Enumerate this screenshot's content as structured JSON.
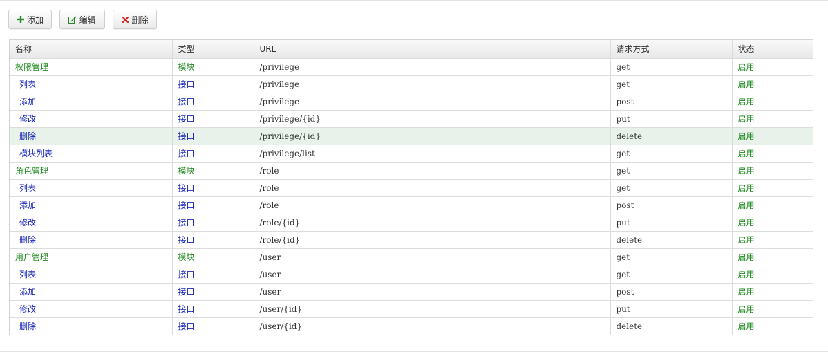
{
  "colors": {
    "module": "#1e8a1e",
    "api": "#1a27b8",
    "status": "#1e8a1e",
    "highlight_row": "#e8f2ea",
    "add_icon": "#2a8a2a",
    "delete_icon": "#d42020"
  },
  "toolbar": {
    "add_label": "添加",
    "add_icon": "plus-icon",
    "edit_label": "编辑",
    "edit_icon": "edit-icon",
    "delete_label": "删除",
    "delete_icon": "close-icon"
  },
  "table": {
    "columns": [
      "名称",
      "类型",
      "URL",
      "请求方式",
      "状态"
    ],
    "rows": [
      {
        "name": "权限管理",
        "type": "模块",
        "url": "/privilege",
        "method": "get",
        "status": "启用",
        "level": "module"
      },
      {
        "name": "列表",
        "type": "接口",
        "url": "/privilege",
        "method": "get",
        "status": "启用",
        "level": "api"
      },
      {
        "name": "添加",
        "type": "接口",
        "url": "/privilege",
        "method": "post",
        "status": "启用",
        "level": "api"
      },
      {
        "name": "修改",
        "type": "接口",
        "url": "/privilege/{id}",
        "method": "put",
        "status": "启用",
        "level": "api"
      },
      {
        "name": "删除",
        "type": "接口",
        "url": "/privilege/{id}",
        "method": "delete",
        "status": "启用",
        "level": "api",
        "highlighted": true
      },
      {
        "name": "模块列表",
        "type": "接口",
        "url": "/privilege/list",
        "method": "get",
        "status": "启用",
        "level": "api"
      },
      {
        "name": "角色管理",
        "type": "模块",
        "url": "/role",
        "method": "get",
        "status": "启用",
        "level": "module"
      },
      {
        "name": "列表",
        "type": "接口",
        "url": "/role",
        "method": "get",
        "status": "启用",
        "level": "api"
      },
      {
        "name": "添加",
        "type": "接口",
        "url": "/role",
        "method": "post",
        "status": "启用",
        "level": "api"
      },
      {
        "name": "修改",
        "type": "接口",
        "url": "/role/{id}",
        "method": "put",
        "status": "启用",
        "level": "api"
      },
      {
        "name": "删除",
        "type": "接口",
        "url": "/role/{id}",
        "method": "delete",
        "status": "启用",
        "level": "api"
      },
      {
        "name": "用户管理",
        "type": "模块",
        "url": "/user",
        "method": "get",
        "status": "启用",
        "level": "module"
      },
      {
        "name": "列表",
        "type": "接口",
        "url": "/user",
        "method": "get",
        "status": "启用",
        "level": "api"
      },
      {
        "name": "添加",
        "type": "接口",
        "url": "/user",
        "method": "post",
        "status": "启用",
        "level": "api"
      },
      {
        "name": "修改",
        "type": "接口",
        "url": "/user/{id}",
        "method": "put",
        "status": "启用",
        "level": "api"
      },
      {
        "name": "删除",
        "type": "接口",
        "url": "/user/{id}",
        "method": "delete",
        "status": "启用",
        "level": "api"
      }
    ]
  }
}
